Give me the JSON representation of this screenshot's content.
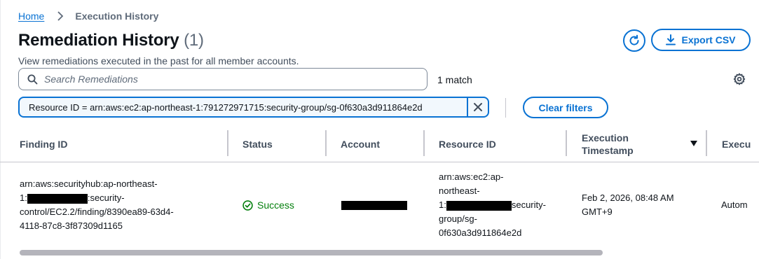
{
  "breadcrumb": {
    "home": "Home",
    "current": "Execution History"
  },
  "header": {
    "title": "Remediation History",
    "count": "(1)",
    "description": "View remediations executed in the past for all member accounts.",
    "export_label": "Export CSV"
  },
  "search": {
    "placeholder": "Search Remediations",
    "match_count": "1 match"
  },
  "filter": {
    "token_label": "Resource ID = arn:aws:ec2:ap-northeast-1:791272971715:security-group/sg-0f630a3d911864e2d",
    "clear_label": "Clear filters"
  },
  "table": {
    "columns": [
      "Finding ID",
      "Status",
      "Account",
      "Resource ID",
      "Execution Timestamp",
      "Execu"
    ],
    "execution_timestamp_lines": [
      "Execution",
      "Timestamp"
    ],
    "row": {
      "finding_id": {
        "line1": "arn:aws:securityhub:ap-northeast-",
        "line2_prefix": "1:",
        "line2_suffix": ":security-",
        "line3": "control/EC2.2/finding/8390ea89-63d4-",
        "line4": "4118-87c8-3f87309d1165"
      },
      "status": "Success",
      "resource_id": {
        "line1": "arn:aws:ec2:ap-",
        "line2": "northeast-",
        "line3_prefix": "1:",
        "line3_suffix": "security-",
        "line4": "group/sg-",
        "line5": "0f630a3d911864e2d"
      },
      "timestamp": {
        "line1": "Feb 2, 2026, 08:48 AM",
        "line2": "GMT+9"
      },
      "executor": "Autom"
    }
  },
  "colors": {
    "accent": "#0972d3",
    "success": "#037f0c",
    "border": "#c6c6cd"
  }
}
